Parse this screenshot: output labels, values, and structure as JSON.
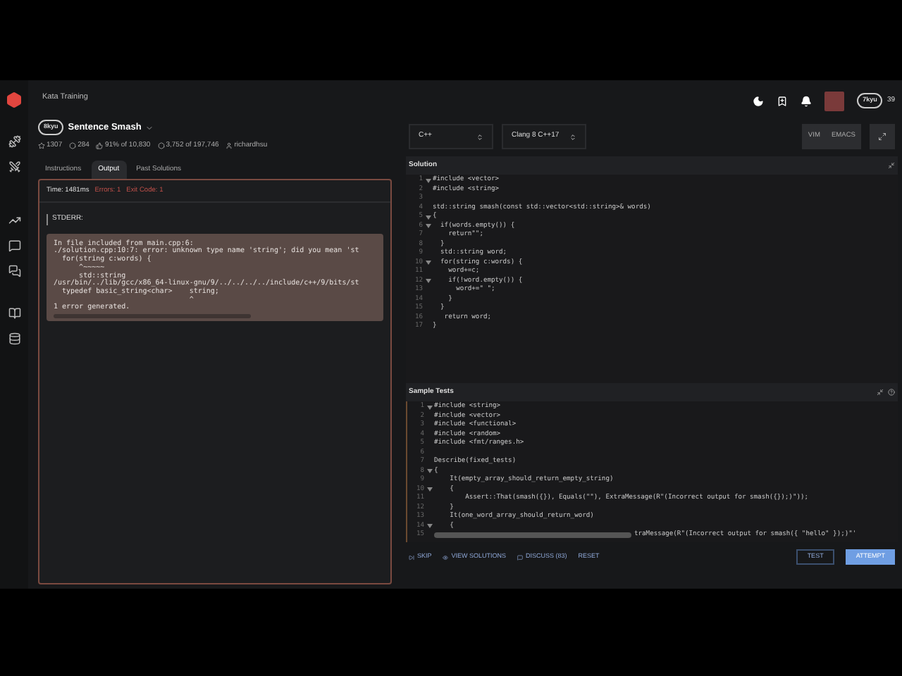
{
  "breadcrumb": "Kata Training",
  "kata": {
    "rank": "8kyu",
    "title": "Sentence Smash",
    "stats": [
      {
        "kind": "star",
        "text": "1307"
      },
      {
        "kind": "hex",
        "text": "284"
      },
      {
        "kind": "thumb",
        "text": "91% of 10,830"
      },
      {
        "kind": "hex",
        "text": "3,752 of 197,746"
      },
      {
        "kind": "user",
        "text": "richardhsu"
      }
    ]
  },
  "tabs": [
    {
      "label": "Instructions",
      "selected": false
    },
    {
      "label": "Output",
      "selected": true
    },
    {
      "label": "Past Solutions",
      "selected": false
    }
  ],
  "output": {
    "time": "Time: 1481ms",
    "errors": "Errors: 1",
    "exit_code": "Exit Code: 1",
    "stderr_label": "STDERR:",
    "stderr_lines": [
      "In file included from main.cpp:6:",
      "./solution.cpp:10:7: error: unknown type name 'string'; did you mean 'st",
      "  for(string c:words) {",
      "      ^~~~~~",
      "      std::string",
      "/usr/bin/../lib/gcc/x86_64-linux-gnu/9/../../../../include/c++/9/bits/st",
      "  typedef basic_string<char>    string;",
      "                                ^",
      "1 error generated."
    ]
  },
  "user": {
    "rank": "7kyu",
    "honor": "39"
  },
  "language": "C++",
  "version": "Clang 8 C++17",
  "modes": [
    "VIM",
    "EMACS"
  ],
  "solution": {
    "title": "Solution",
    "lines": [
      {
        "n": "1",
        "fold": true,
        "text": "#include <vector>"
      },
      {
        "n": "2",
        "fold": false,
        "text": "#include <string>"
      },
      {
        "n": "3",
        "fold": false
      },
      {
        "n": "4",
        "fold": false,
        "text": "std::string smash(const std::vector<std::string>& words)"
      },
      {
        "n": "5",
        "fold": true,
        "text": "{"
      },
      {
        "n": "6",
        "fold": true,
        "text": "  if(words.empty()) {"
      },
      {
        "n": "7",
        "fold": false,
        "text": "    return\"\";"
      },
      {
        "n": "8",
        "fold": false,
        "text": "  }"
      },
      {
        "n": "9",
        "fold": false,
        "text": "  std::string word;"
      },
      {
        "n": "10",
        "fold": true,
        "text": "  for(string c:words) {"
      },
      {
        "n": "11",
        "fold": false,
        "text": "    word+=c;"
      },
      {
        "n": "12",
        "fold": true,
        "text": "    if(!word.empty()) {"
      },
      {
        "n": "13",
        "fold": false,
        "text": "      word+=\" \";"
      },
      {
        "n": "14",
        "fold": false,
        "text": "    }"
      },
      {
        "n": "15",
        "fold": false,
        "text": "  }"
      },
      {
        "n": "16",
        "fold": false,
        "text": "   return word;"
      },
      {
        "n": "17",
        "fold": false,
        "text": "}"
      }
    ]
  },
  "sample_tests": {
    "title": "Sample Tests",
    "lines": [
      {
        "n": "1",
        "fold": true,
        "kind": "code",
        "text": "#include <string>"
      },
      {
        "n": "2",
        "fold": false,
        "kind": "code",
        "text": "#include <vector>"
      },
      {
        "n": "3",
        "fold": false,
        "kind": "code",
        "text": "#include <functional>"
      },
      {
        "n": "4",
        "fold": false,
        "kind": "code",
        "text": "#include <random>"
      },
      {
        "n": "5",
        "fold": false,
        "kind": "code",
        "text": "#include <fmt/ranges.h>"
      },
      {
        "n": "6",
        "fold": false,
        "kind": "code"
      },
      {
        "n": "7",
        "fold": false,
        "kind": "code",
        "text": "Describe(fixed_tests)"
      },
      {
        "n": "8",
        "fold": true,
        "kind": "code",
        "text": "{"
      },
      {
        "n": "9",
        "fold": false,
        "kind": "code",
        "text": "    It(empty_array_should_return_empty_string)"
      },
      {
        "n": "10",
        "fold": true,
        "kind": "code",
        "text": "    {"
      },
      {
        "n": "11",
        "fold": false,
        "kind": "code",
        "text": "        Assert::That(smash({}), Equals(\"\"), ExtraMessage(R\"(Incorrect output for smash({});)\"));"
      },
      {
        "n": "12",
        "fold": false,
        "kind": "code",
        "text": "    }"
      },
      {
        "n": "13",
        "fold": false,
        "kind": "code",
        "text": "    It(one_word_array_should_return_word)"
      },
      {
        "n": "14",
        "fold": true,
        "kind": "code",
        "text": "    {"
      },
      {
        "n": "15",
        "fold": false,
        "kind": "covered",
        "text": "traMessage(R\"(Incorrect output for smash({ \"hello\" });)\"'"
      }
    ]
  },
  "actions": [
    {
      "kind": "skip",
      "label": "SKIP"
    },
    {
      "kind": "solutions",
      "label": "VIEW SOLUTIONS"
    },
    {
      "kind": "discuss",
      "label": "DISCUSS (83)"
    },
    {
      "kind": "plain",
      "label": "RESET"
    }
  ],
  "buttons": [
    {
      "label": "TEST",
      "primary": false
    },
    {
      "label": "ATTEMPT",
      "primary": true
    }
  ]
}
